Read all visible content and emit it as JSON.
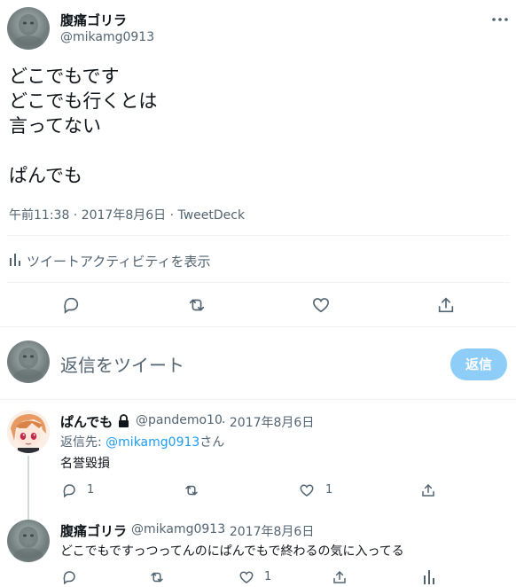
{
  "main_tweet": {
    "author_name": "腹痛ゴリラ",
    "handle": "@mikamg0913",
    "text_lines": [
      "どこでもです",
      "どこでも行くとは",
      "言ってない",
      "",
      "ぱんでも"
    ],
    "meta": "午前11:38 · 2017年8月6日 · TweetDeck",
    "activity_label": "ツイートアクティビティを表示",
    "more_icon": "more-dots-icon"
  },
  "compose": {
    "placeholder": "返信をツイート",
    "button_label": "返信"
  },
  "replies": [
    {
      "author_name": "ぱんでも",
      "locked": true,
      "handle": "@pandemo10",
      "date": "· 2017年8月6日",
      "reply_to_prefix": "返信先: ",
      "reply_to_handle": "@mikamg0913",
      "reply_to_suffix": "さん",
      "text": "名誉毀損",
      "reply_count": "1",
      "like_count": "1"
    },
    {
      "author_name": "腹痛ゴリラ",
      "handle": "@mikamg0913",
      "date": "· 2017年8月6日",
      "text": "どこでもですっつってんのにぱんでもで終わるの気に入ってる",
      "reply_count": "",
      "like_count": "1"
    }
  ],
  "colors": {
    "accent": "#1d9bf0",
    "reply_button_disabled": "#8ecdf8",
    "muted_text": "#536471"
  }
}
